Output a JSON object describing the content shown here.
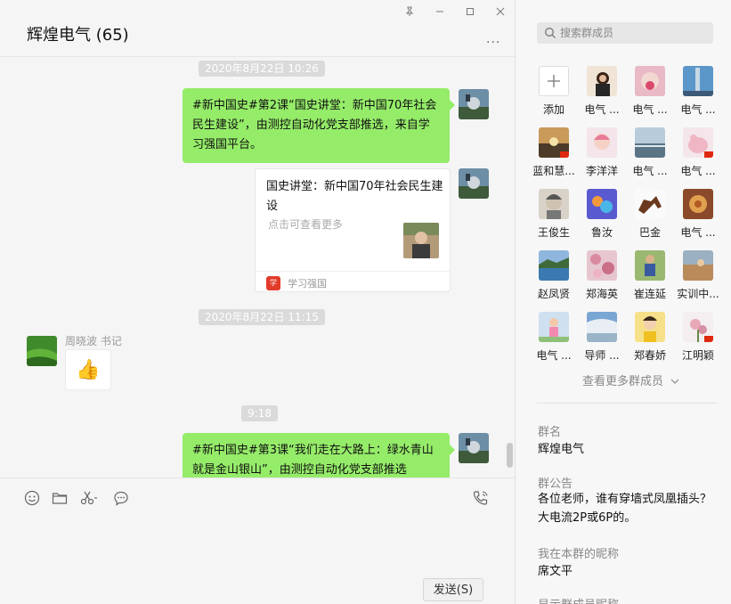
{
  "chat": {
    "title": "辉煌电气 (65)",
    "more_label": "...",
    "messages": {
      "t1": "2020年8月22日 10:26",
      "m1": "#新中国史#第2课“国史讲堂：新中国70年社会民生建设”，由测控自动化党支部推选，来自学习强国平台。",
      "card": {
        "title": "国史讲堂：新中国70年社会民生建设",
        "desc": "点击可查看更多",
        "source": "学习强国"
      },
      "t2": "2020年8月22日 11:15",
      "sender": "周晓波 书记",
      "sticker": "👍",
      "t3": "9:18",
      "m2": "#新中国史#第3课“我们走在大路上：绿水青山就是金山银山”，由测控自动化党支部推选"
    },
    "send_label": "发送(S)"
  },
  "panel": {
    "search_placeholder": "搜索群成员",
    "members": [
      {
        "name": "添加"
      },
      {
        "name": "电气 ..."
      },
      {
        "name": "电气 ..."
      },
      {
        "name": "电气 ..."
      },
      {
        "name": "蓝和慧..."
      },
      {
        "name": "李洋洋"
      },
      {
        "name": "电气 ..."
      },
      {
        "name": "电气 ..."
      },
      {
        "name": "王俊生"
      },
      {
        "name": "鲁汝"
      },
      {
        "name": "巴金"
      },
      {
        "name": "电气 ..."
      },
      {
        "name": "赵凤贤"
      },
      {
        "name": "郑海英"
      },
      {
        "name": "崔连延"
      },
      {
        "name": "实训中..."
      },
      {
        "name": "电气 ..."
      },
      {
        "name": "导师 ..."
      },
      {
        "name": "郑春娇"
      },
      {
        "name": "江明颖"
      }
    ],
    "view_more": "查看更多群成员",
    "group_name_label": "群名",
    "group_name": "辉煌电气",
    "notice_label": "群公告",
    "notice": "各位老师，谁有穿墙式凤凰插头？大电流2P或6P的。",
    "nickname_label": "我在本群的昵称",
    "nickname": "席文平",
    "show_nick_label": "显示群成员昵称"
  }
}
